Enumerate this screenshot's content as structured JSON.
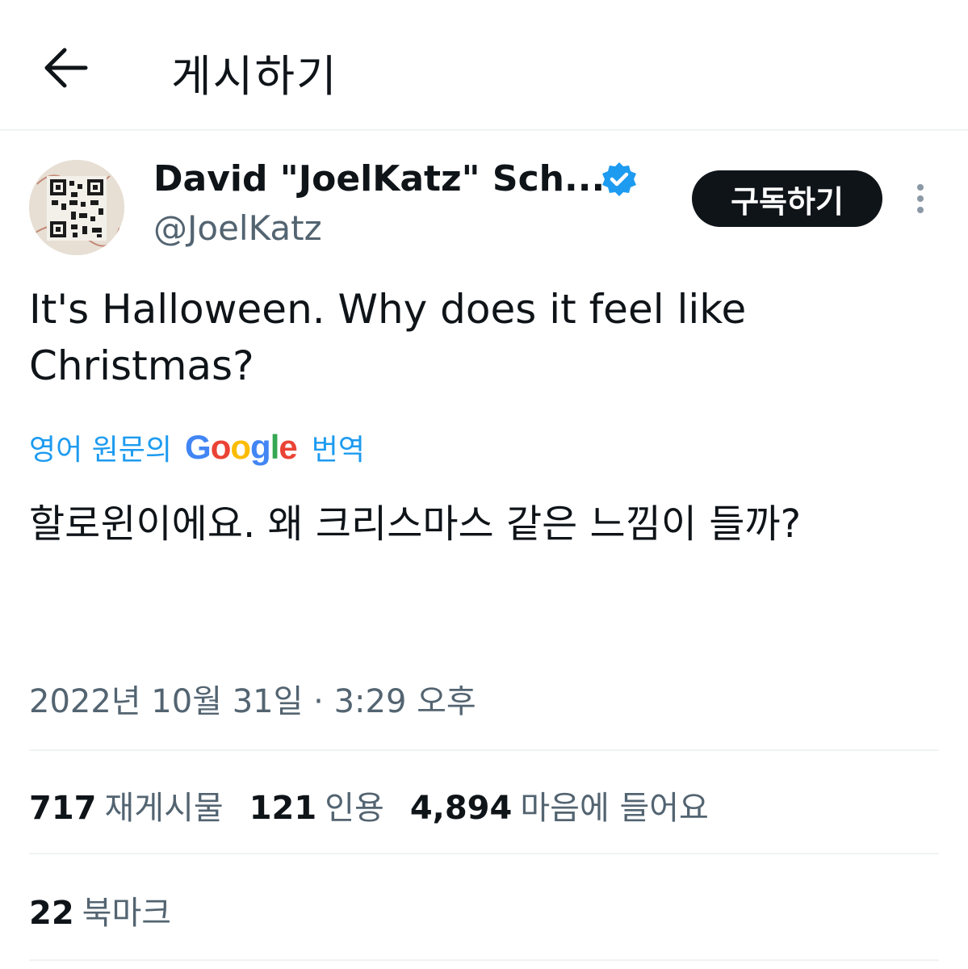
{
  "header": {
    "title": "게시하기",
    "back_icon": "arrow-left-icon"
  },
  "author": {
    "display_name": "David \"JoelKatz\" Sch...",
    "handle": "@JoelKatz",
    "verified_icon": "verified-badge-icon",
    "verified_color": "#1d9bf0"
  },
  "subscribe_label": "구독하기",
  "more_icon": "more-vertical-icon",
  "tweet": {
    "text": "It's Halloween. Why does it feel like Christmas?",
    "translate_prefix": "영어 원문의",
    "translate_brand": "Google",
    "translate_suffix": "번역",
    "translated_text": "할로윈이에요. 왜 크리스마스 같은 느낌이 들까?",
    "timestamp": "2022년 10월 31일 · 3:29 오후"
  },
  "stats": [
    {
      "count": "717",
      "label": "재게시물"
    },
    {
      "count": "121",
      "label": "인용"
    },
    {
      "count": "4,894",
      "label": "마음에 들어요"
    }
  ],
  "bookmarks": {
    "count": "22",
    "label": "북마크"
  },
  "colors": {
    "text": "#0f1419",
    "secondary": "#536471",
    "accent": "#1d9bf0",
    "divider": "#eff3f4"
  }
}
